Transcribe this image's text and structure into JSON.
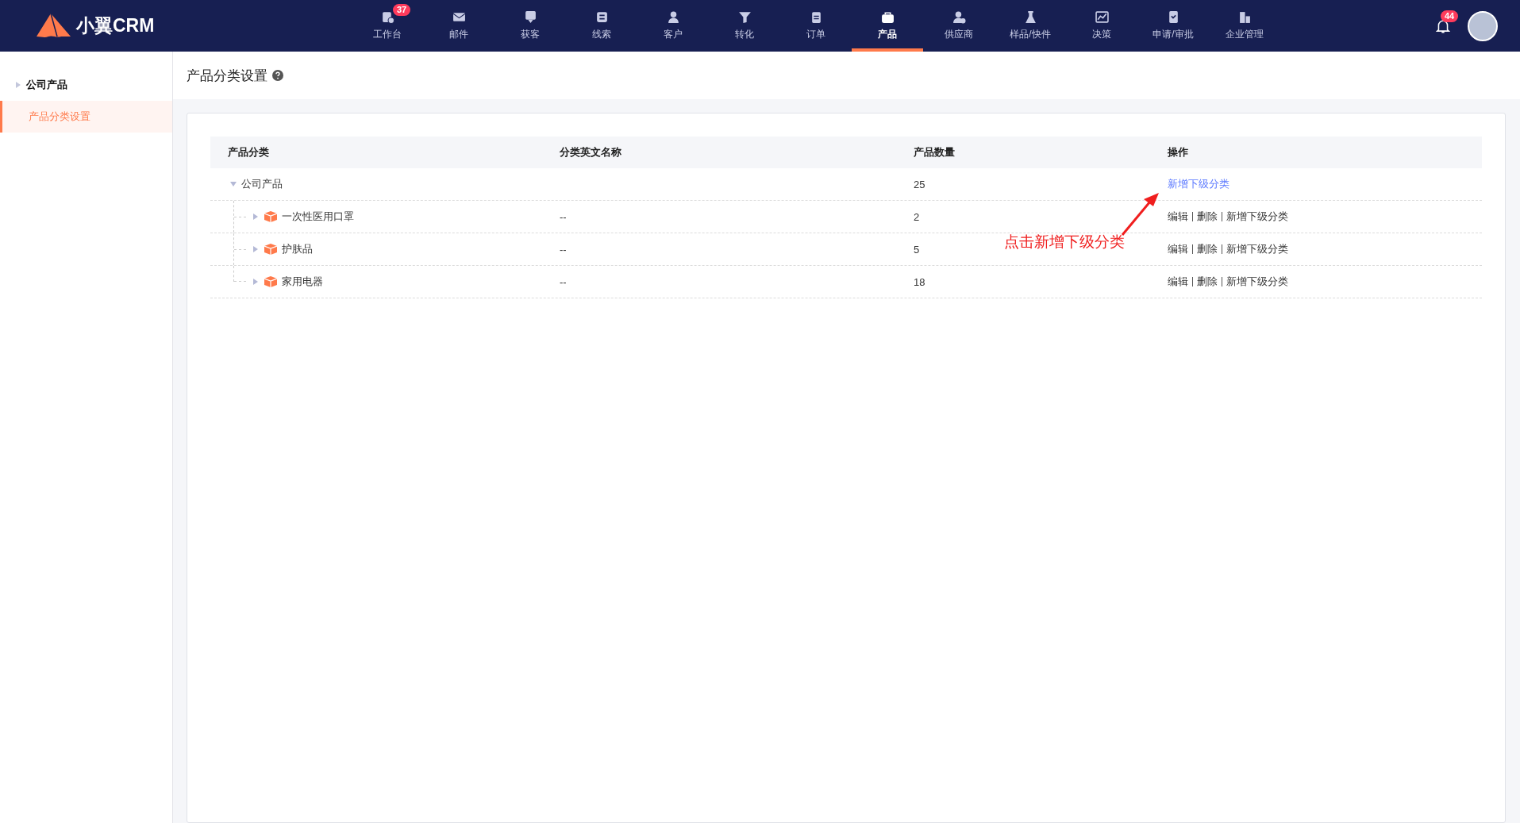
{
  "brand": {
    "name": "小翼CRM"
  },
  "nav": [
    {
      "label": "工作台",
      "kind": "workbench",
      "selected": false,
      "badge": "37"
    },
    {
      "label": "邮件",
      "kind": "mail",
      "selected": false
    },
    {
      "label": "获客",
      "kind": "board",
      "selected": false
    },
    {
      "label": "线索",
      "kind": "clue",
      "selected": false
    },
    {
      "label": "客户",
      "kind": "person",
      "selected": false
    },
    {
      "label": "转化",
      "kind": "funnel",
      "selected": false
    },
    {
      "label": "订单",
      "kind": "clipboard",
      "selected": false
    },
    {
      "label": "产品",
      "kind": "bag",
      "selected": true
    },
    {
      "label": "供应商",
      "kind": "supplier",
      "selected": false
    },
    {
      "label": "样品/快件",
      "kind": "flask",
      "selected": false
    },
    {
      "label": "决策",
      "kind": "chart",
      "selected": false
    },
    {
      "label": "申请/审批",
      "kind": "approve",
      "selected": false
    },
    {
      "label": "企业管理",
      "kind": "building",
      "selected": false
    }
  ],
  "notifications": {
    "badge": "44"
  },
  "sidebar": {
    "items": [
      {
        "label": "公司产品",
        "kind": "group"
      },
      {
        "label": "产品分类设置",
        "kind": "link",
        "selected": true
      }
    ]
  },
  "page_title": "产品分类设置",
  "table": {
    "columns": [
      "产品分类",
      "分类英文名称",
      "产品数量",
      "操作"
    ],
    "rows": [
      {
        "name": "公司产品",
        "expanded": true,
        "count": "25",
        "actions": [
          {
            "label": "新增下级分类",
            "hovered": true
          }
        ],
        "children": [
          {
            "name": "一次性医用口罩",
            "expanded": false,
            "english": "--",
            "count": "2",
            "actions": [
              {
                "label": "编辑",
                "hovered": false
              },
              {
                "label": "删除",
                "hovered": false
              },
              {
                "label": "新增下级分类",
                "hovered": false
              }
            ]
          },
          {
            "name": "护肤品",
            "expanded": false,
            "english": "--",
            "count": "5",
            "actions": [
              {
                "label": "编辑",
                "hovered": false
              },
              {
                "label": "删除",
                "hovered": false
              },
              {
                "label": "新增下级分类",
                "hovered": false
              }
            ]
          },
          {
            "name": "家用电器",
            "expanded": false,
            "english": "--",
            "count": "18",
            "actions": [
              {
                "label": "编辑",
                "hovered": false
              },
              {
                "label": "删除",
                "hovered": false
              },
              {
                "label": "新增下级分类",
                "hovered": false
              }
            ]
          }
        ]
      }
    ]
  },
  "annotation": {
    "text": "点击新增下级分类"
  }
}
